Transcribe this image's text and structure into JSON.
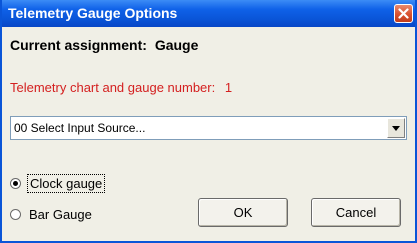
{
  "window": {
    "title": "Telemetry Gauge Options",
    "accent_color": "#0a55d8",
    "close_icon": "close-icon"
  },
  "assignment": {
    "label": "Current assignment:",
    "value": "Gauge"
  },
  "gauge_number": {
    "label": "Telemetry chart and gauge number:",
    "value": "1",
    "color": "#d42020"
  },
  "input_source": {
    "selected": "00 Select Input Source...",
    "arrow_icon": "chevron-down-icon"
  },
  "gauge_type": {
    "options": [
      {
        "label": "Clock gauge",
        "checked": true
      },
      {
        "label": "Bar Gauge",
        "checked": false
      }
    ]
  },
  "buttons": {
    "ok": "OK",
    "cancel": "Cancel"
  }
}
